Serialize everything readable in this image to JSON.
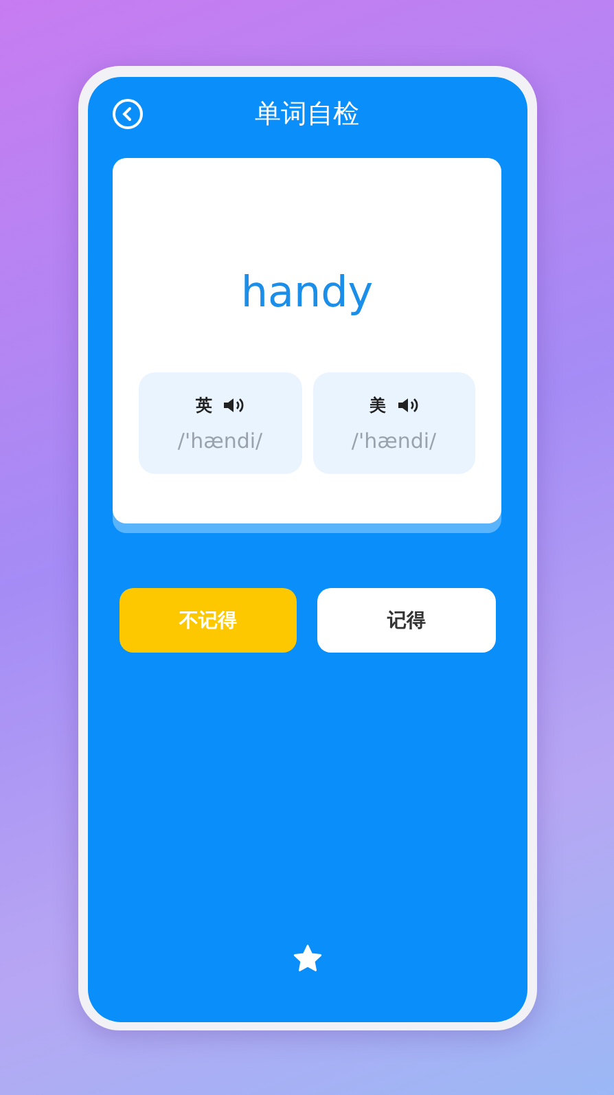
{
  "header": {
    "title": "单词自检"
  },
  "word_card": {
    "word": "handy",
    "pronunciations": [
      {
        "accent": "英",
        "phonetic": "/'hændi/"
      },
      {
        "accent": "美",
        "phonetic": "/'hændi/"
      }
    ]
  },
  "answer_buttons": [
    {
      "label": "不记得",
      "kind": "forgot"
    },
    {
      "label": "记得",
      "kind": "remembered"
    }
  ]
}
